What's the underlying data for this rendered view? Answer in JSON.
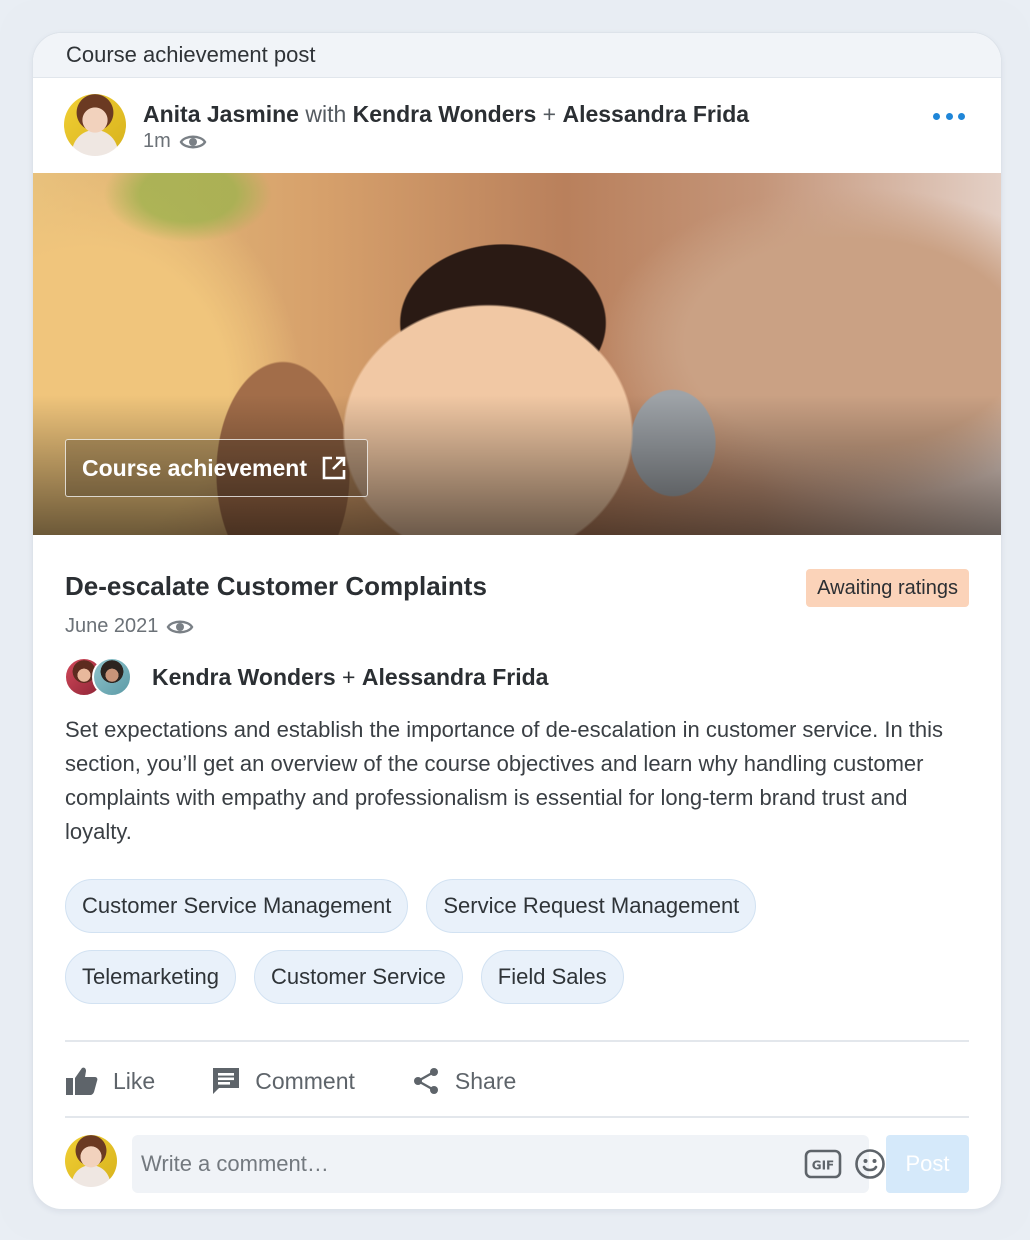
{
  "card": {
    "header_title": "Course achievement post"
  },
  "post": {
    "author": "Anita Jasmine",
    "with_text": "with",
    "collaborator_1": "Kendra Wonders",
    "plus": "+",
    "collaborator_2": "Alessandra Frida",
    "time": "1m",
    "more_icon": "more-horizontal-icon"
  },
  "hero": {
    "button_label": "Course achievement",
    "button_icon": "external-link-icon"
  },
  "course": {
    "title": "De-escalate Customer Complaints",
    "status_badge": "Awaiting ratings",
    "date": "June 2021",
    "collaborator_1": "Kendra Wonders",
    "plus": "+",
    "collaborator_2": "Alessandra Frida",
    "description": "Set expectations and establish the importance of de-escalation in customer service. In this section, you’ll get an overview of the course objectives and learn why handling customer complaints with empathy and professionalism is essential for long-term brand trust and loyalty.",
    "tags": [
      "Customer Service Management",
      "Service Request Management",
      "Telemarketing",
      "Customer Service",
      "Field Sales"
    ]
  },
  "actions": {
    "like": "Like",
    "comment": "Comment",
    "share": "Share"
  },
  "comment_box": {
    "placeholder": "Write a comment…",
    "post_label": "Post"
  },
  "colors": {
    "accent": "#1f86d8",
    "badge_bg": "#fbd3b9",
    "tag_bg": "#e9f1fa",
    "post_disabled": "#d5e9fa"
  }
}
